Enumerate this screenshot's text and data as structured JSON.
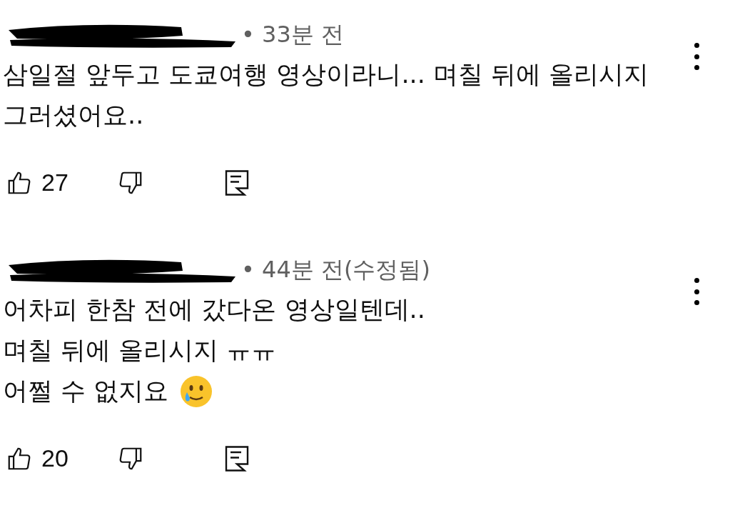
{
  "comments": [
    {
      "time": "• 33분 전",
      "lines": [
        {
          "kind": "plain",
          "text": "삼일절 앞두고 도쿄여행 영상이라니... 며칠 뒤에 올리시지"
        },
        {
          "kind": "plain",
          "text": "그러셨어요.."
        }
      ],
      "likes": "27"
    },
    {
      "time": "• 44분 전(수정됨)",
      "lines": [
        {
          "kind": "plain",
          "text": "어차피 한참 전에 갔다온 영상일텐데.."
        },
        {
          "kind": "plain",
          "text": "며칠 뒤에 올리시지 ㅠㅠ"
        },
        {
          "kind": "with-emoji",
          "text": "어쩔 수 없지요"
        }
      ],
      "likes": "20"
    }
  ]
}
